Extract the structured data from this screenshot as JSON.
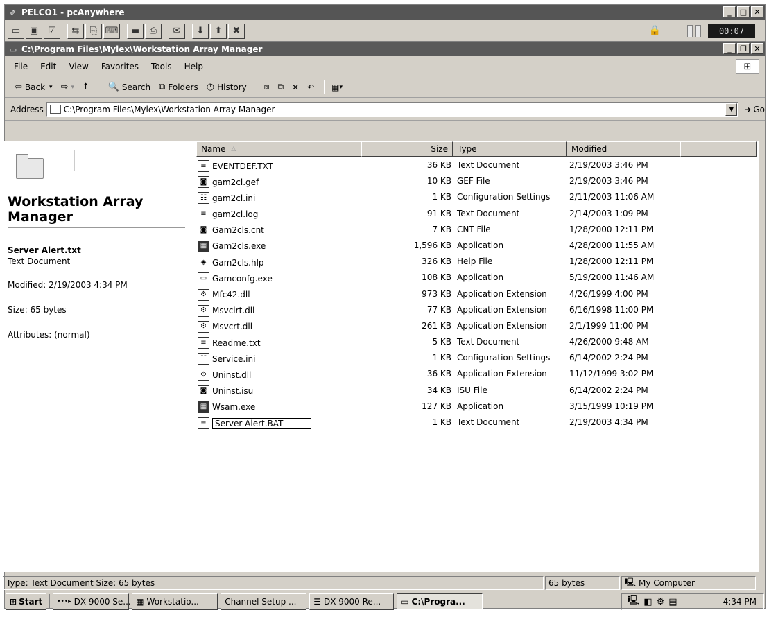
{
  "pca": {
    "title": "PELCO1 - pcAnywhere",
    "timer": "00:07",
    "tool_icons": [
      "pane-icon",
      "pane2-icon",
      "properties-icon",
      "transfer-icon",
      "clipboard-icon",
      "keys-icon",
      "screen-icon",
      "print-icon",
      "chat-icon",
      "send-icon",
      "receive-icon",
      "end-icon"
    ]
  },
  "explorer": {
    "title": "C:\\Program Files\\Mylex\\Workstation Array Manager",
    "menu": [
      "File",
      "Edit",
      "View",
      "Favorites",
      "Tools",
      "Help"
    ],
    "toolbar": {
      "back": "Back",
      "search": "Search",
      "folders": "Folders",
      "history": "History"
    },
    "address": {
      "label": "Address",
      "value": "C:\\Program Files\\Mylex\\Workstation Array Manager",
      "go": "Go"
    }
  },
  "left_pane": {
    "folder_title": "Workstation Array Manager",
    "selected_name": "Server Alert.txt",
    "selected_type": "Text Document",
    "modified": "Modified: 2/19/2003 4:34 PM",
    "size": "Size: 65 bytes",
    "attributes": "Attributes: (normal)"
  },
  "columns": {
    "name": "Name",
    "size": "Size",
    "type": "Type",
    "modified": "Modified"
  },
  "files": [
    {
      "name": "EVENTDEF.TXT",
      "size": "36 KB",
      "type": "Text Document",
      "modified": "2/19/2003 3:46 PM",
      "icon": "text"
    },
    {
      "name": "gam2cl.gef",
      "size": "10 KB",
      "type": "GEF File",
      "modified": "2/19/2003 3:46 PM",
      "icon": "generic"
    },
    {
      "name": "gam2cl.ini",
      "size": "1 KB",
      "type": "Configuration Settings",
      "modified": "2/11/2003 11:06 AM",
      "icon": "config"
    },
    {
      "name": "gam2cl.log",
      "size": "91 KB",
      "type": "Text Document",
      "modified": "2/14/2003 1:09 PM",
      "icon": "text"
    },
    {
      "name": "Gam2cls.cnt",
      "size": "7 KB",
      "type": "CNT File",
      "modified": "1/28/2000 12:11 PM",
      "icon": "generic"
    },
    {
      "name": "Gam2cls.exe",
      "size": "1,596 KB",
      "type": "Application",
      "modified": "4/28/2000 11:55 AM",
      "icon": "app"
    },
    {
      "name": "Gam2cls.hlp",
      "size": "326 KB",
      "type": "Help File",
      "modified": "1/28/2000 12:11 PM",
      "icon": "help"
    },
    {
      "name": "Gamconfg.exe",
      "size": "108 KB",
      "type": "Application",
      "modified": "5/19/2000 11:46 AM",
      "icon": "window"
    },
    {
      "name": "Mfc42.dll",
      "size": "973 KB",
      "type": "Application Extension",
      "modified": "4/26/1999 4:00 PM",
      "icon": "dll"
    },
    {
      "name": "Msvcirt.dll",
      "size": "77 KB",
      "type": "Application Extension",
      "modified": "6/16/1998 11:00 PM",
      "icon": "dll"
    },
    {
      "name": "Msvcrt.dll",
      "size": "261 KB",
      "type": "Application Extension",
      "modified": "2/1/1999 11:00 PM",
      "icon": "dll"
    },
    {
      "name": "Readme.txt",
      "size": "5 KB",
      "type": "Text Document",
      "modified": "4/26/2000 9:48 AM",
      "icon": "text"
    },
    {
      "name": "Service.ini",
      "size": "1 KB",
      "type": "Configuration Settings",
      "modified": "6/14/2002 2:24 PM",
      "icon": "config"
    },
    {
      "name": "Uninst.dll",
      "size": "36 KB",
      "type": "Application Extension",
      "modified": "11/12/1999 3:02 PM",
      "icon": "dll"
    },
    {
      "name": "Uninst.isu",
      "size": "34 KB",
      "type": "ISU File",
      "modified": "6/14/2002 2:24 PM",
      "icon": "generic"
    },
    {
      "name": "Wsam.exe",
      "size": "127 KB",
      "type": "Application",
      "modified": "3/15/1999 10:19 PM",
      "icon": "app"
    },
    {
      "name": "Server Alert.BAT",
      "size": "1 KB",
      "type": "Text Document",
      "modified": "2/19/2003 4:34 PM",
      "icon": "text",
      "renaming": true
    }
  ],
  "status": {
    "left": "Type: Text Document Size: 65 bytes",
    "size": "65 bytes",
    "zone": "My Computer"
  },
  "taskbar": {
    "start": "Start",
    "buttons": [
      "DX 9000 Se...",
      "Workstatio...",
      "Channel Setup ...",
      "DX 9000 Re...",
      "C:\\Progra..."
    ],
    "active_index": 4,
    "clock": "4:34 PM"
  }
}
